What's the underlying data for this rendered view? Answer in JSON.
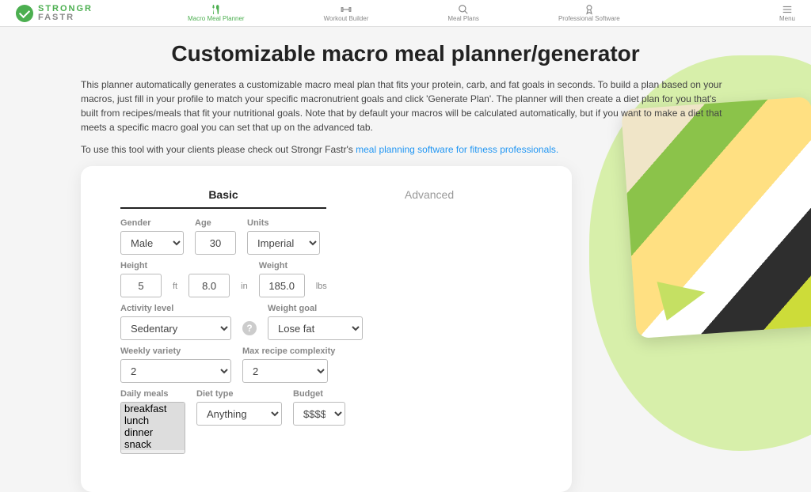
{
  "brand": {
    "line1": "STRONGR",
    "line2": "FASTR"
  },
  "nav": {
    "items": [
      {
        "label": "Macro Meal Planner"
      },
      {
        "label": "Workout Builder"
      },
      {
        "label": "Meal Plans"
      },
      {
        "label": "Professional Software"
      }
    ],
    "menu": "Menu"
  },
  "page": {
    "title": "Customizable macro meal planner/generator",
    "desc1": "This planner automatically generates a customizable macro meal plan that fits your protein, carb, and fat goals in seconds. To build a plan based on your macros, just fill in your profile to match your specific macronutrient goals and click 'Generate Plan'. The planner will then create a diet plan for you that's built from recipes/meals that fit your nutritional goals. Note that by default your macros will be calculated automatically, but if you want to make a diet that meets a specific macro goal you can set that up on the advanced tab.",
    "desc2_prefix": "To use this tool with your clients please check out Strongr Fastr's ",
    "desc2_link": "meal planning software for fitness professionals.",
    "tabs": {
      "basic": "Basic",
      "advanced": "Advanced"
    }
  },
  "form": {
    "gender": {
      "label": "Gender",
      "value": "Male"
    },
    "age": {
      "label": "Age",
      "value": "30"
    },
    "units": {
      "label": "Units",
      "value": "Imperial"
    },
    "height": {
      "label": "Height",
      "feet": "5",
      "ft_unit": "ft",
      "inches": "8.0",
      "in_unit": "in"
    },
    "weight": {
      "label": "Weight",
      "value": "185.0",
      "unit": "lbs"
    },
    "activity": {
      "label": "Activity level",
      "value": "Sedentary"
    },
    "goal": {
      "label": "Weight goal",
      "value": "Lose fat"
    },
    "variety": {
      "label": "Weekly variety",
      "value": "2"
    },
    "complexity": {
      "label": "Max recipe complexity",
      "value": "2"
    },
    "meals": {
      "label": "Daily meals",
      "options": [
        "breakfast",
        "lunch",
        "dinner",
        "snack"
      ]
    },
    "diet": {
      "label": "Diet type",
      "value": "Anything"
    },
    "budget": {
      "label": "Budget",
      "value": "$$$$"
    }
  }
}
